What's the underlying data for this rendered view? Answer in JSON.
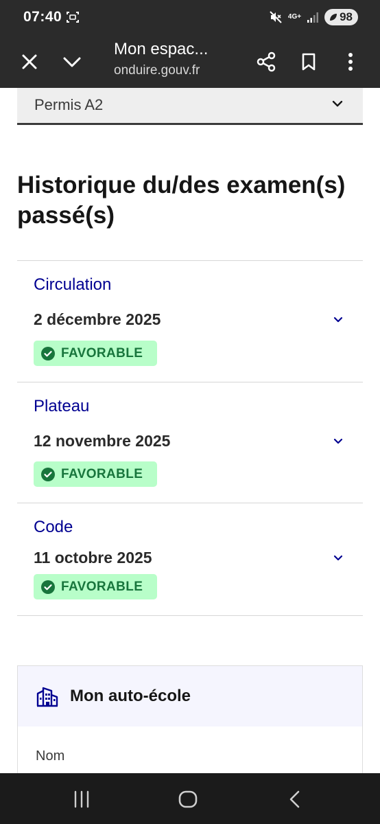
{
  "status_bar": {
    "time": "07:40",
    "network": "4G+",
    "battery": "98",
    "icons": [
      "screenshot-icon",
      "mute-icon",
      "signal-icon",
      "battery-icon"
    ]
  },
  "browser": {
    "page_title": "Mon espac...",
    "url": "onduire.gouv.fr",
    "icons": [
      "close-icon",
      "chevron-down-icon",
      "share-icon",
      "bookmark-icon",
      "more-vert-icon"
    ]
  },
  "permit_select": {
    "value": "Permis A2"
  },
  "history": {
    "title": "Historique du/des examen(s) passé(s)",
    "exams": [
      {
        "name": "Circulation",
        "date": "2 décembre 2025",
        "result": "FAVORABLE"
      },
      {
        "name": "Plateau",
        "date": "12 novembre 2025",
        "result": "FAVORABLE"
      },
      {
        "name": "Code",
        "date": "11 octobre 2025",
        "result": "FAVORABLE"
      }
    ]
  },
  "driving_school": {
    "title": "Mon auto-école",
    "field_label": "Nom"
  },
  "colors": {
    "accent_blue": "#000091",
    "success_bg": "#b8fec9",
    "success_text": "#18753c",
    "chrome_bg": "#2b2b2b"
  }
}
